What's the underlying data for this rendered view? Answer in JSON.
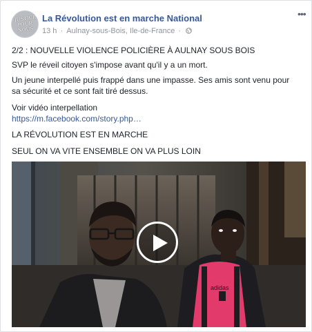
{
  "post": {
    "page_name": "La Révolution est en marche National",
    "avatar_text": "JUSTICE POUR NOUS",
    "time": "13 h",
    "location": "Aulnay-sous-Bois, Ile-de-France",
    "privacy_icon": "globe-icon",
    "more_icon": "more-options-icon",
    "more_label": "•••",
    "paragraphs": {
      "line1": "2/2 : NOUVELLE VIOLENCE POLICIÈRE À AULNAY SOUS BOIS",
      "line2": "SVP le réveil citoyen s'impose avant qu'il y a un mort.",
      "line3a": "Un jeune interpellé puis frappé dans une impasse. Ses amis sont venu pour",
      "line3b": "sa sécurité et ce sont fait tiré dessus.",
      "line4": "Voir vidéo interpellation",
      "link": "https://m.facebook.com/story.php…",
      "line5": "LA RÉVOLUTION EST EN MARCHE",
      "line6": "SEUL ON VA VITE ENSEMBLE ON VA PLUS LOIN"
    },
    "video": {
      "play_icon": "play-icon",
      "jersey_text": "adidas"
    }
  }
}
